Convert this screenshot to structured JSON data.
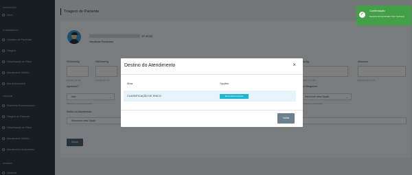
{
  "sidebar": {
    "section_navegacao": "NAVEGAÇÃO",
    "section_atendimento": "ATENDIMENTO",
    "section_triagem": "TRIAGEM",
    "section_sistema": "SISTEMA",
    "items": [
      {
        "label": "Início"
      },
      {
        "label": "Cadastro de Pacientes"
      },
      {
        "label": "Triagem"
      },
      {
        "label": "Classificação de Risco"
      },
      {
        "label": "Atendimento Médico"
      },
      {
        "label": "Alta Ambulatorial"
      },
      {
        "label": "Pacientes Encaminhados"
      },
      {
        "label": "Triagem do Paciente"
      },
      {
        "label": "Classificação de Risco"
      },
      {
        "label": "Atendimento Médico"
      },
      {
        "label": "Atendimento Ambulatorio"
      },
      {
        "label": "Usuários"
      }
    ]
  },
  "page": {
    "title": "Triagem do Paciente",
    "patient_age": "19 anos)",
    "view_records": "Visualizar Prontuário",
    "vitals": [
      {
        "label": "PAS/mmHg",
        "help": "Intervalo: 0-0 / 90"
      },
      {
        "label": "PAD/mmHg",
        "help": "Intervalo: 0-0 / 50"
      },
      {
        "label": "Peso/kg",
        "help": "Intervalo: 20 -1,000"
      },
      {
        "label": "Altura/cm",
        "help": "Intervalo: 60-0 a 2,75"
      }
    ],
    "agravado_label": "Agravado?",
    "agravado_value": "Não",
    "agravado_help": "Informe se o paciente agravado?",
    "tipo_sanguineo_label": "Tipo Sanguíneo",
    "tipo_sanguineo_value": "Selecione uma Opção",
    "tipo_sanguineo_help": "Tipo Sanguíneo do Paciente",
    "motivo_label": "Motivo do Atendimento",
    "motivo_value": "Selecione uma Opção",
    "save_label": "Salvar"
  },
  "modal": {
    "title": "Destino do Atendimento",
    "close_label": "×",
    "col_area": "Área",
    "col_opcoes": "Opções",
    "row_area": "CLASSIFICAÇÃO DE RISCO",
    "row_button": "Encaminhar Paciente",
    "back_label": "Voltar"
  },
  "toast": {
    "title": "Confirmação",
    "message": "Paciente Encaminhado Com Sucesso!",
    "color": "#43a047"
  }
}
